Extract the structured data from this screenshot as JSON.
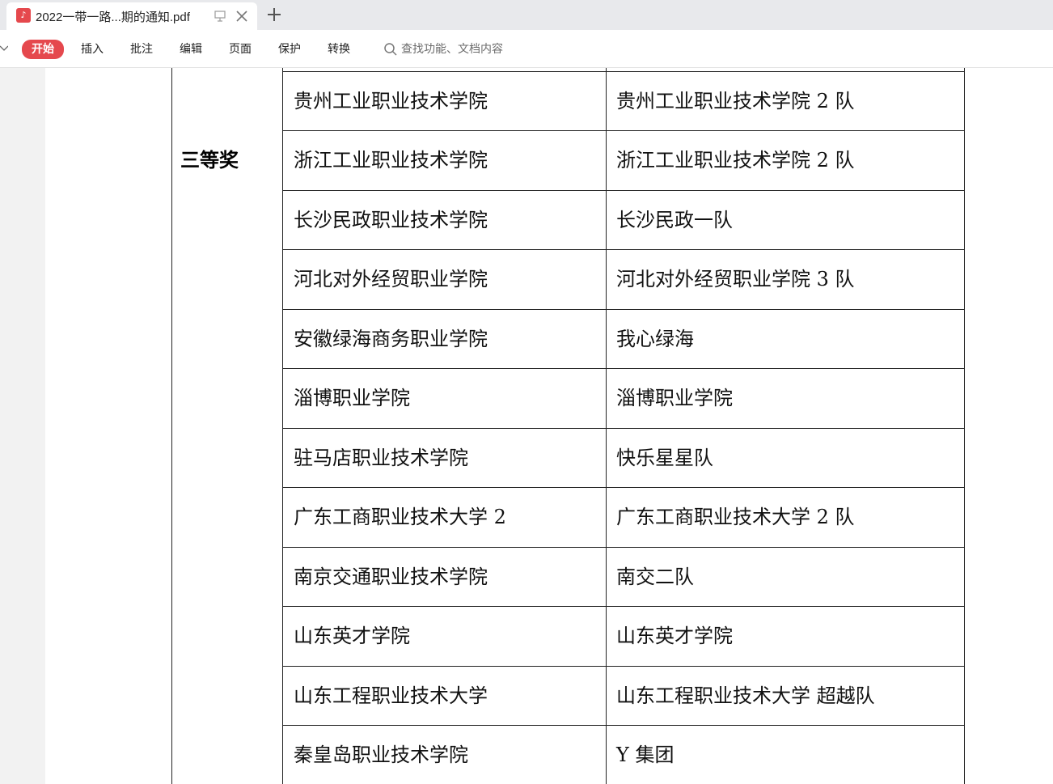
{
  "tab": {
    "title": "2022一带一路...期的通知.pdf",
    "icon": "pdf-file-icon"
  },
  "toolbar": {
    "menu": [
      "开始",
      "插入",
      "批注",
      "编辑",
      "页面",
      "保护",
      "转换"
    ],
    "active_index": 0,
    "search_placeholder": "查找功能、文档内容",
    "accent_color": "#e5484d"
  },
  "document": {
    "award_label": "三等奖",
    "rows": [
      {
        "school": "贵州工业职业技术学院",
        "team": "贵州工业职业技术学院 2 队"
      },
      {
        "school": "浙江工业职业技术学院",
        "team": "浙江工业职业技术学院 2 队"
      },
      {
        "school": "长沙民政职业技术学院",
        "team": "长沙民政一队"
      },
      {
        "school": "河北对外经贸职业学院",
        "team": "河北对外经贸职业学院 3 队"
      },
      {
        "school": "安徽绿海商务职业学院",
        "team": "我心绿海"
      },
      {
        "school": "淄博职业学院",
        "team": "淄博职业学院"
      },
      {
        "school": "驻马店职业技术学院",
        "team": "快乐星星队"
      },
      {
        "school": "广东工商职业技术大学 2",
        "team": "广东工商职业技术大学 2 队"
      },
      {
        "school": "南京交通职业技术学院",
        "team": "南交二队"
      },
      {
        "school": "山东英才学院",
        "team": "山东英才学院"
      },
      {
        "school": "山东工程职业技术大学",
        "team": "山东工程职业技术大学  超越队"
      },
      {
        "school": "秦皇岛职业技术学院",
        "team": "Y 集团"
      }
    ]
  }
}
